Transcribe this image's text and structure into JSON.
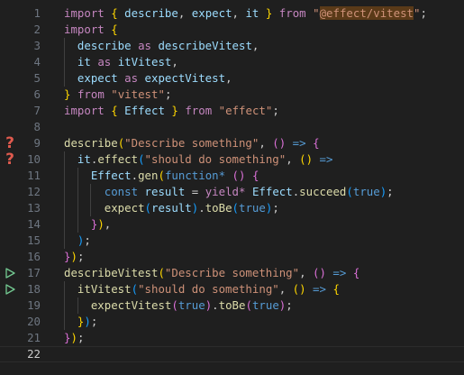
{
  "editor": {
    "lines": [
      {
        "num": "1",
        "marker": "",
        "tokens": [
          [
            "kw",
            "import"
          ],
          [
            "pn",
            " "
          ],
          [
            "br1",
            "{"
          ],
          [
            "pn",
            " "
          ],
          [
            "var",
            "describe"
          ],
          [
            "pn",
            ", "
          ],
          [
            "var",
            "expect"
          ],
          [
            "pn",
            ", "
          ],
          [
            "var",
            "it"
          ],
          [
            "pn",
            " "
          ],
          [
            "br1",
            "}"
          ],
          [
            "pn",
            " "
          ],
          [
            "kw",
            "from"
          ],
          [
            "pn",
            " "
          ],
          [
            "str",
            "\""
          ],
          [
            "hl",
            "@effect/vitest"
          ],
          [
            "str",
            "\""
          ],
          [
            "pn",
            ";"
          ]
        ]
      },
      {
        "num": "2",
        "marker": "",
        "tokens": [
          [
            "kw",
            "import"
          ],
          [
            "pn",
            " "
          ],
          [
            "br1",
            "{"
          ]
        ]
      },
      {
        "num": "3",
        "marker": "",
        "tokens": [
          [
            "pn",
            "  "
          ],
          [
            "var",
            "describe"
          ],
          [
            "pn",
            " "
          ],
          [
            "kw",
            "as"
          ],
          [
            "pn",
            " "
          ],
          [
            "var",
            "describeVitest"
          ],
          [
            "pn",
            ","
          ]
        ]
      },
      {
        "num": "4",
        "marker": "",
        "tokens": [
          [
            "pn",
            "  "
          ],
          [
            "var",
            "it"
          ],
          [
            "pn",
            " "
          ],
          [
            "kw",
            "as"
          ],
          [
            "pn",
            " "
          ],
          [
            "var",
            "itVitest"
          ],
          [
            "pn",
            ","
          ]
        ]
      },
      {
        "num": "5",
        "marker": "",
        "tokens": [
          [
            "pn",
            "  "
          ],
          [
            "var",
            "expect"
          ],
          [
            "pn",
            " "
          ],
          [
            "kw",
            "as"
          ],
          [
            "pn",
            " "
          ],
          [
            "var",
            "expectVitest"
          ],
          [
            "pn",
            ","
          ]
        ]
      },
      {
        "num": "6",
        "marker": "",
        "tokens": [
          [
            "br1",
            "}"
          ],
          [
            "pn",
            " "
          ],
          [
            "kw",
            "from"
          ],
          [
            "pn",
            " "
          ],
          [
            "str",
            "\"vitest\""
          ],
          [
            "pn",
            ";"
          ]
        ]
      },
      {
        "num": "7",
        "marker": "",
        "tokens": [
          [
            "kw",
            "import"
          ],
          [
            "pn",
            " "
          ],
          [
            "br1",
            "{"
          ],
          [
            "pn",
            " "
          ],
          [
            "var",
            "Effect"
          ],
          [
            "pn",
            " "
          ],
          [
            "br1",
            "}"
          ],
          [
            "pn",
            " "
          ],
          [
            "kw",
            "from"
          ],
          [
            "pn",
            " "
          ],
          [
            "str",
            "\"effect\""
          ],
          [
            "pn",
            ";"
          ]
        ]
      },
      {
        "num": "8",
        "marker": "",
        "tokens": []
      },
      {
        "num": "9",
        "marker": "question",
        "tokens": [
          [
            "fn",
            "describe"
          ],
          [
            "br1",
            "("
          ],
          [
            "str",
            "\"Describe something\""
          ],
          [
            "pn",
            ", "
          ],
          [
            "br2",
            "()"
          ],
          [
            "pn",
            " "
          ],
          [
            "kb",
            "=>"
          ],
          [
            "pn",
            " "
          ],
          [
            "br2",
            "{"
          ]
        ]
      },
      {
        "num": "10",
        "marker": "question",
        "tokens": [
          [
            "pn",
            "  "
          ],
          [
            "var",
            "it"
          ],
          [
            "pn",
            "."
          ],
          [
            "fn",
            "effect"
          ],
          [
            "br3",
            "("
          ],
          [
            "str",
            "\"should do something\""
          ],
          [
            "pn",
            ", "
          ],
          [
            "br1",
            "()"
          ],
          [
            "pn",
            " "
          ],
          [
            "kb",
            "=>"
          ]
        ]
      },
      {
        "num": "11",
        "marker": "",
        "tokens": [
          [
            "pn",
            "    "
          ],
          [
            "var",
            "Effect"
          ],
          [
            "pn",
            "."
          ],
          [
            "fn",
            "gen"
          ],
          [
            "br1",
            "("
          ],
          [
            "kb",
            "function*"
          ],
          [
            "pn",
            " "
          ],
          [
            "br2",
            "()"
          ],
          [
            "pn",
            " "
          ],
          [
            "br2",
            "{"
          ]
        ]
      },
      {
        "num": "12",
        "marker": "",
        "tokens": [
          [
            "pn",
            "      "
          ],
          [
            "kb",
            "const"
          ],
          [
            "pn",
            " "
          ],
          [
            "var",
            "result"
          ],
          [
            "pn",
            " = "
          ],
          [
            "kw",
            "yield*"
          ],
          [
            "pn",
            " "
          ],
          [
            "var",
            "Effect"
          ],
          [
            "pn",
            "."
          ],
          [
            "fn",
            "succeed"
          ],
          [
            "br3",
            "("
          ],
          [
            "kb",
            "true"
          ],
          [
            "br3",
            ")"
          ],
          [
            "pn",
            ";"
          ]
        ]
      },
      {
        "num": "13",
        "marker": "",
        "tokens": [
          [
            "pn",
            "      "
          ],
          [
            "fn",
            "expect"
          ],
          [
            "br3",
            "("
          ],
          [
            "var",
            "result"
          ],
          [
            "br3",
            ")"
          ],
          [
            "pn",
            "."
          ],
          [
            "fn",
            "toBe"
          ],
          [
            "br3",
            "("
          ],
          [
            "kb",
            "true"
          ],
          [
            "br3",
            ")"
          ],
          [
            "pn",
            ";"
          ]
        ]
      },
      {
        "num": "14",
        "marker": "",
        "tokens": [
          [
            "pn",
            "    "
          ],
          [
            "br2",
            "}"
          ],
          [
            "br1",
            ")"
          ],
          [
            "pn",
            ","
          ]
        ]
      },
      {
        "num": "15",
        "marker": "",
        "tokens": [
          [
            "pn",
            "  "
          ],
          [
            "br3",
            ")"
          ],
          [
            "pn",
            ";"
          ]
        ]
      },
      {
        "num": "16",
        "marker": "",
        "tokens": [
          [
            "br2",
            "}"
          ],
          [
            "br1",
            ")"
          ],
          [
            "pn",
            ";"
          ]
        ]
      },
      {
        "num": "17",
        "marker": "run",
        "tokens": [
          [
            "fn",
            "describeVitest"
          ],
          [
            "br1",
            "("
          ],
          [
            "str",
            "\"Describe something\""
          ],
          [
            "pn",
            ", "
          ],
          [
            "br2",
            "()"
          ],
          [
            "pn",
            " "
          ],
          [
            "kb",
            "=>"
          ],
          [
            "pn",
            " "
          ],
          [
            "br2",
            "{"
          ]
        ]
      },
      {
        "num": "18",
        "marker": "run",
        "tokens": [
          [
            "pn",
            "  "
          ],
          [
            "fn",
            "itVitest"
          ],
          [
            "br3",
            "("
          ],
          [
            "str",
            "\"should do something\""
          ],
          [
            "pn",
            ", "
          ],
          [
            "br1",
            "()"
          ],
          [
            "pn",
            " "
          ],
          [
            "kb",
            "=>"
          ],
          [
            "pn",
            " "
          ],
          [
            "br1",
            "{"
          ]
        ]
      },
      {
        "num": "19",
        "marker": "",
        "tokens": [
          [
            "pn",
            "    "
          ],
          [
            "fn",
            "expectVitest"
          ],
          [
            "br2",
            "("
          ],
          [
            "kb",
            "true"
          ],
          [
            "br2",
            ")"
          ],
          [
            "pn",
            "."
          ],
          [
            "fn",
            "toBe"
          ],
          [
            "br2",
            "("
          ],
          [
            "kb",
            "true"
          ],
          [
            "br2",
            ")"
          ],
          [
            "pn",
            ";"
          ]
        ]
      },
      {
        "num": "20",
        "marker": "",
        "tokens": [
          [
            "pn",
            "  "
          ],
          [
            "br1",
            "}"
          ],
          [
            "br3",
            ")"
          ],
          [
            "pn",
            ";"
          ]
        ]
      },
      {
        "num": "21",
        "marker": "",
        "tokens": [
          [
            "br2",
            "}"
          ],
          [
            "br1",
            ")"
          ],
          [
            "pn",
            ";"
          ]
        ]
      },
      {
        "num": "22",
        "marker": "",
        "current": true,
        "tokens": []
      }
    ]
  }
}
